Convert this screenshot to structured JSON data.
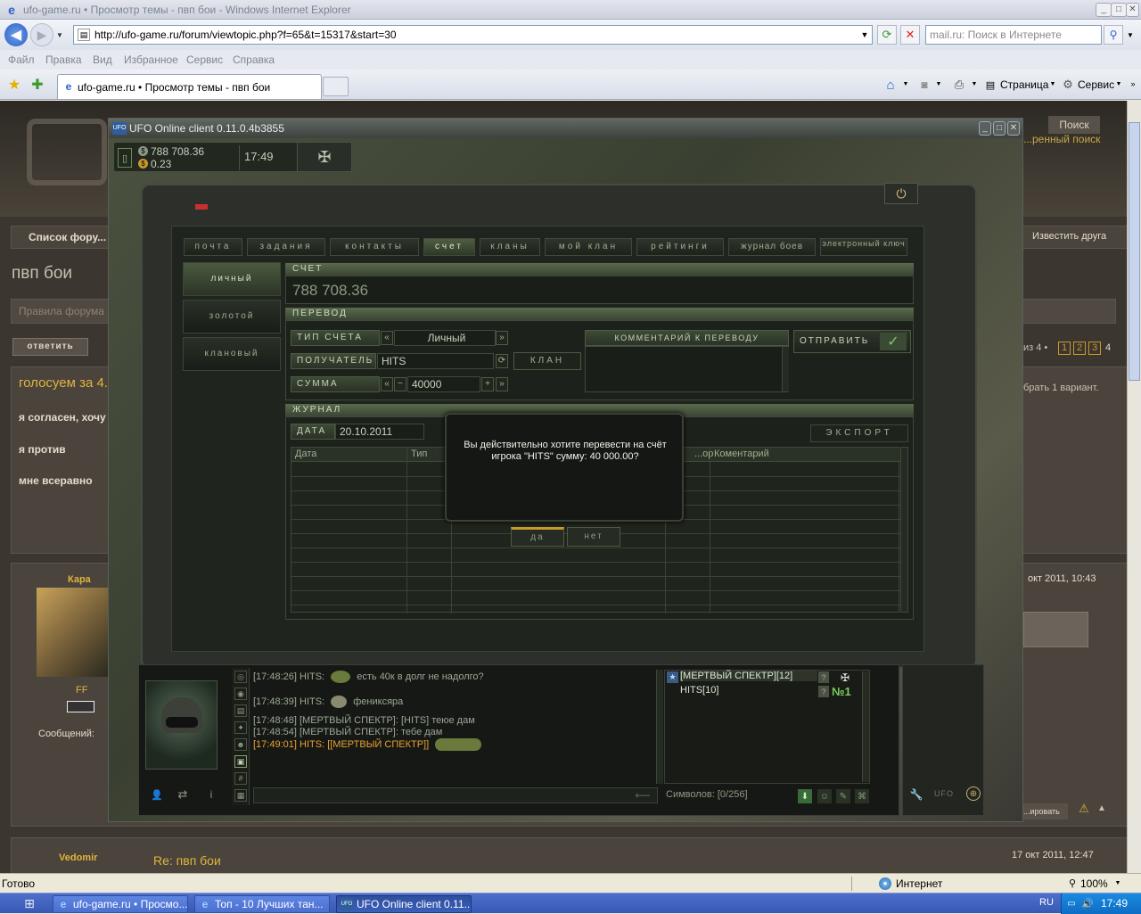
{
  "ie": {
    "title": "ufo-game.ru • Просмотр темы - пвп бои - Windows Internet Explorer",
    "url": "http://ufo-game.ru/forum/viewtopic.php?f=65&t=15317&start=30",
    "search_placeholder": "mail.ru: Поиск в Интернете",
    "menu": [
      "Файл",
      "Правка",
      "Вид",
      "Избранное",
      "Сервис",
      "Справка"
    ],
    "tab_label": "ufo-game.ru • Просмотр темы - пвп бои",
    "tools": {
      "page": "Страница",
      "service": "Сервис"
    },
    "status_left": "Готово",
    "status_zone": "Интернет",
    "zoom": "100%"
  },
  "taskbar": {
    "tasks": [
      "ufo-game.ru • Просмо...",
      "Топ - 10 Лучших тан...",
      "UFO Online client 0.11..."
    ],
    "lang": "RU",
    "time": "17:49"
  },
  "site": {
    "search_btn": "Поиск",
    "adv_search": "...ренный поиск",
    "breadcrumb": "Список фору...",
    "notify": "Известить друга",
    "topic_title": "пвп бои",
    "rules_link": "Правила форума",
    "reply_btn": "ответить",
    "pages_prefix": "из 4 •",
    "pages": [
      "1",
      "2",
      "3",
      "4"
    ],
    "poll_title": "голосуем за 4...",
    "poll_hint": "брать 1 вариант.",
    "poll_options": [
      "я согласен, хочу",
      "я против",
      "мне всеравно"
    ],
    "post1_author": "Кара",
    "post1_rank": "FF",
    "post1_msgs": "Сообщений:",
    "post1_date": "окт 2011, 10:43",
    "quote_btn": "...ировать",
    "post2_author": "Vedomir",
    "post2_title": "Re: пвп бои",
    "post2_date": "17 окт 2011, 12:47"
  },
  "client": {
    "title": "UFO Online client 0.11.0.4b3855",
    "money": "788 708.36",
    "gold": "0.23",
    "time": "17:49",
    "tabs": [
      "почта",
      "задания",
      "контакты",
      "счет",
      "кланы",
      "мой клан",
      "рейтинги",
      "журнал боев",
      "электронный ключ"
    ],
    "active_tab": "счет",
    "side": [
      "личный",
      "золотой",
      "клановый"
    ],
    "account": {
      "header": "СЧЕТ",
      "value": "788 708.36"
    },
    "transfer": {
      "header": "ПЕРЕВОД",
      "type_label": "ТИП СЧЕТА",
      "type_value": "Личный",
      "recipient_label": "ПОЛУЧАТЕЛЬ",
      "recipient_value": "HITS",
      "clan_btn": "КЛАН",
      "sum_label": "СУММА",
      "sum_value": "40000",
      "comment_label": "КОММЕНТАРИЙ К ПЕРЕВОДУ",
      "send_btn": "ОТПРАВИТЬ"
    },
    "journal": {
      "header": "ЖУРНАЛ",
      "date_label": "ДАТА",
      "date_value": "20.10.2011",
      "export_btn": "ЭКСПОРТ",
      "cols": [
        "Дата",
        "Тип",
        "...ор",
        "Коментарий"
      ]
    },
    "dialog": {
      "message": "Вы действительно хотите перевести на счёт игрока \"HITS\" сумму: 40 000.00?",
      "yes": "да",
      "no": "нет"
    },
    "chat": [
      {
        "time": "[17:48:26]",
        "who": "HITS:",
        "text": "есть 40к в долг не надолго?"
      },
      {
        "time": "[17:48:39]",
        "who": "HITS:",
        "text": "фениксяра"
      },
      {
        "time": "[17:48:48]",
        "who": "[МЕРТВЫЙ СПЕКТР]:",
        "text": "[HITS] теюе дам"
      },
      {
        "time": "[17:48:54]",
        "who": "[МЕРТВЫЙ СПЕКТР]:",
        "text": "тебе дам"
      },
      {
        "time": "[17:49:01]",
        "who": "HITS:",
        "text": "[[МЕРТВЫЙ СПЕКТР]]"
      }
    ],
    "users": [
      "[МЕРТВЫЙ СПЕКТР][12]",
      "HITS[10]"
    ],
    "symbols": "Символов: [0/256]",
    "badge": "№1",
    "ufo_logo": "UFO"
  }
}
